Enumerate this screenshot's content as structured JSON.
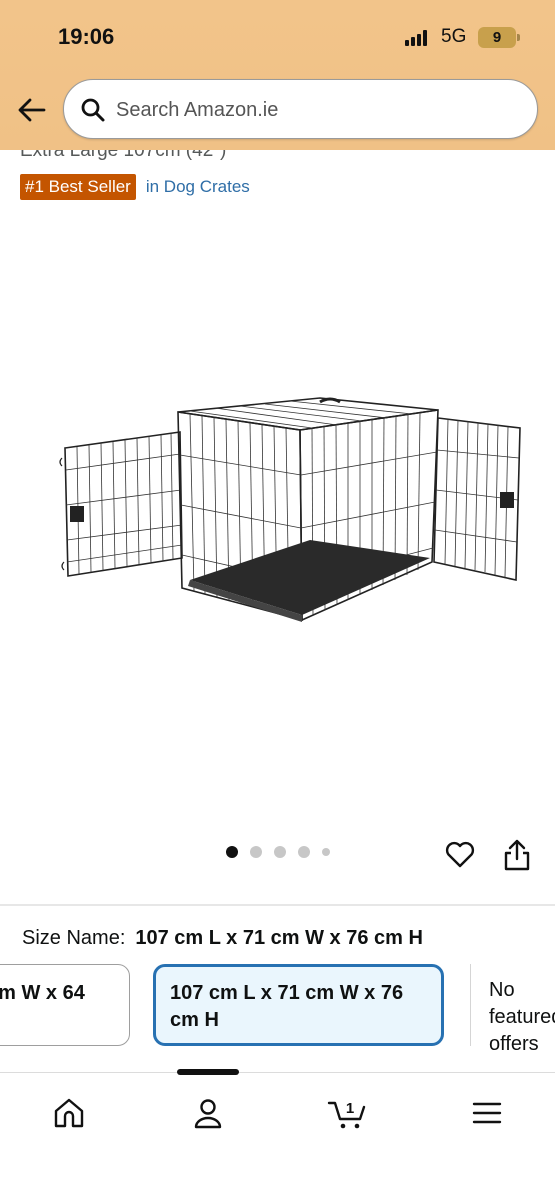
{
  "status_bar": {
    "time": "19:06",
    "network": "5G",
    "battery": "9"
  },
  "search": {
    "placeholder": "Search Amazon.ie"
  },
  "product": {
    "title_fragment": "Extra Large 107cm (42\")",
    "best_seller_badge": "#1 Best Seller",
    "category": "in Dog Crates"
  },
  "carousel": {
    "image_count": 5,
    "active_index": 0
  },
  "size": {
    "label": "Size Name:",
    "selected_value": "107 cm L x 71 cm W x 76 cm H",
    "options": [
      {
        "text": "cm W x 64"
      },
      {
        "text": "107 cm L x 71 cm W x 76 cm H"
      },
      {
        "text": "No featured offers"
      }
    ]
  },
  "bottom_nav": {
    "items": [
      "home-icon",
      "account-icon",
      "cart-icon",
      "menu-icon"
    ],
    "cart_count": "1"
  },
  "colors": {
    "header_bg": "#f2c48a",
    "badge_bg": "#c45500",
    "link": "#2f6ea7",
    "selected_border": "#2771b2",
    "selected_bg": "#eaf6fd"
  }
}
